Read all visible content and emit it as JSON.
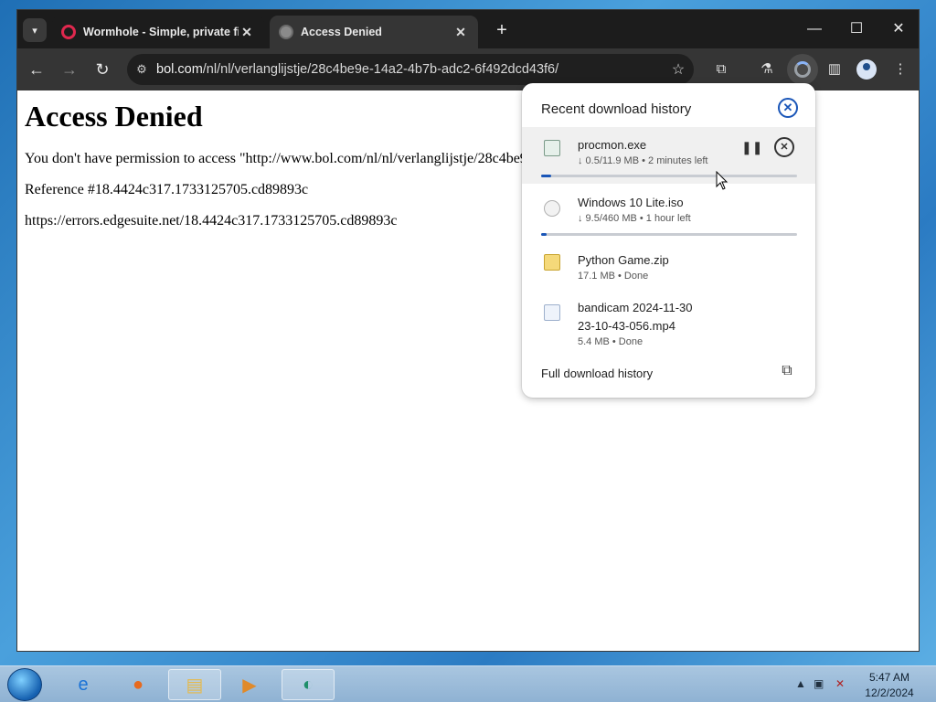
{
  "browser": {
    "tabs": [
      {
        "title": "Wormhole - Simple, private fil",
        "active": false,
        "favicon": "wormhole-icon"
      },
      {
        "title": "Access Denied",
        "active": true,
        "favicon": "globe-icon"
      }
    ],
    "omnibox": {
      "host": "bol.com",
      "path": "/nl/nl/verlanglijstje/28c4be9e-14a2-4b7b-adc2-6f492dcd43f6/"
    }
  },
  "page": {
    "heading": "Access Denied",
    "line1": "You don't have permission to access \"http://www.bol.com/nl/nl/verlanglijstje/28c4be9",
    "line2": "Reference #18.4424c317.1733125705.cd89893c",
    "line3": "https://errors.edgesuite.net/18.4424c317.1733125705.cd89893c"
  },
  "downloads": {
    "title": "Recent download history",
    "items": [
      {
        "name": "procmon.exe",
        "status": "↓ 0.5/11.9 MB • 2 minutes left",
        "progress": 0.04,
        "icon": "exe-file-icon"
      },
      {
        "name": "Windows 10 Lite.iso",
        "status": "↓ 9.5/460 MB • 1 hour left",
        "progress": 0.02,
        "icon": "iso-file-icon"
      },
      {
        "name": "Python Game.zip",
        "status": "17.1 MB • Done",
        "icon": "zip-file-icon"
      },
      {
        "name_line1": "bandicam 2024-11-30",
        "name_line2": "23-10-43-056.mp4",
        "status": "5.4 MB • Done",
        "icon": "video-file-icon"
      }
    ],
    "full_history": "Full download history"
  },
  "taskbar": {
    "time": "5:47 AM",
    "date": "12/2/2024"
  },
  "colors": {
    "accent": "#1a56b8",
    "tabstrip": "#1c1c1c",
    "toolbar": "#353535"
  }
}
